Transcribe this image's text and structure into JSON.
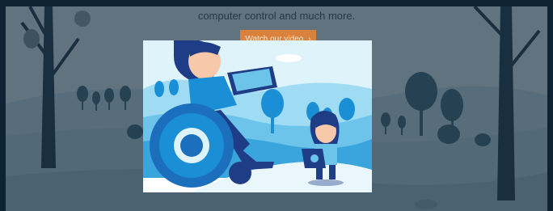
{
  "hero": {
    "tagline": "computer control and much more.",
    "watch_button_label": "Watch our video",
    "watch_button_icon": "chevron-right-icon"
  },
  "video": {
    "scene_description_icons": [
      "wheelchair-user-figure",
      "tablet-device",
      "child-figure"
    ]
  },
  "colors": {
    "frame": "#0d2233",
    "overlay": "#1a3344",
    "button": "#d9823e",
    "sky": "#8fd3ee",
    "wheel": "#1b8fd6",
    "figure_dark": "#1f3c86"
  }
}
